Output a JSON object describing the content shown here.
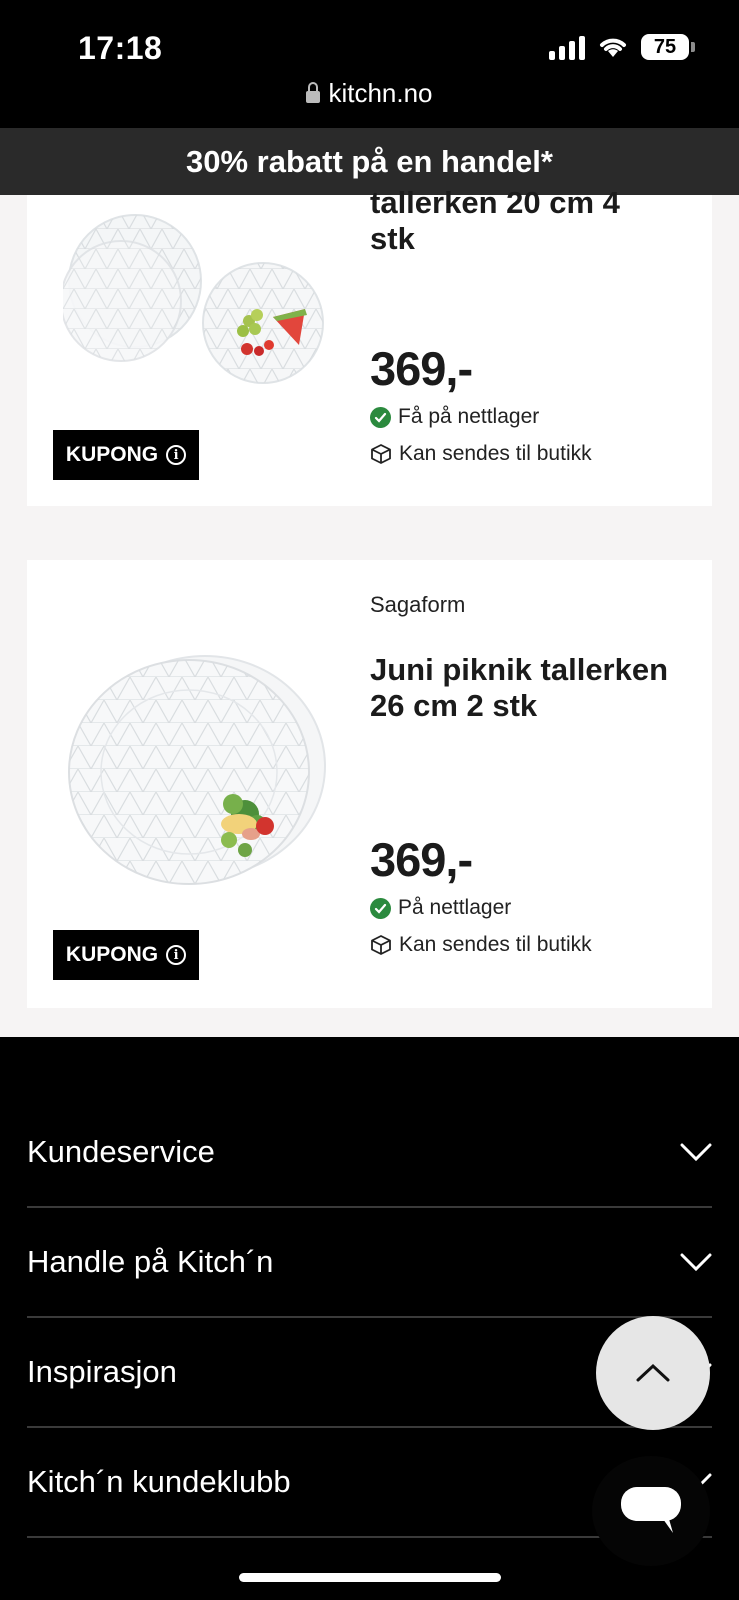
{
  "status": {
    "time": "17:18",
    "battery": "75"
  },
  "browser": {
    "url": "kitchn.no"
  },
  "promo": {
    "text": "30% rabatt på en handel*"
  },
  "products": [
    {
      "name": "tallerken 20 cm 4 stk",
      "price": "369,-",
      "stock": "Få på nettlager",
      "shipping": "Kan sendes til butikk",
      "coupon": "KUPONG"
    },
    {
      "brand": "Sagaform",
      "name": "Juni piknik tallerken 26 cm 2 stk",
      "price": "369,-",
      "stock": "På nettlager",
      "shipping": "Kan sendes til butikk",
      "coupon": "KUPONG"
    }
  ],
  "footer": {
    "items": [
      {
        "label": "Kundeservice"
      },
      {
        "label": "Handle på Kitch´n"
      },
      {
        "label": "Inspirasjon"
      },
      {
        "label": "Kitch´n kundeklubb"
      }
    ]
  },
  "icons": {
    "status_check": "check-circle-icon",
    "shipping": "box-icon",
    "info": "info-icon",
    "expand": "chevron-down-icon",
    "scroll_top": "chevron-up-icon",
    "chat": "chat-bubble-icon"
  },
  "colors": {
    "in_stock": "#2b8a3e",
    "promo_bg": "#2a2a2a",
    "footer_bg": "#000000"
  }
}
